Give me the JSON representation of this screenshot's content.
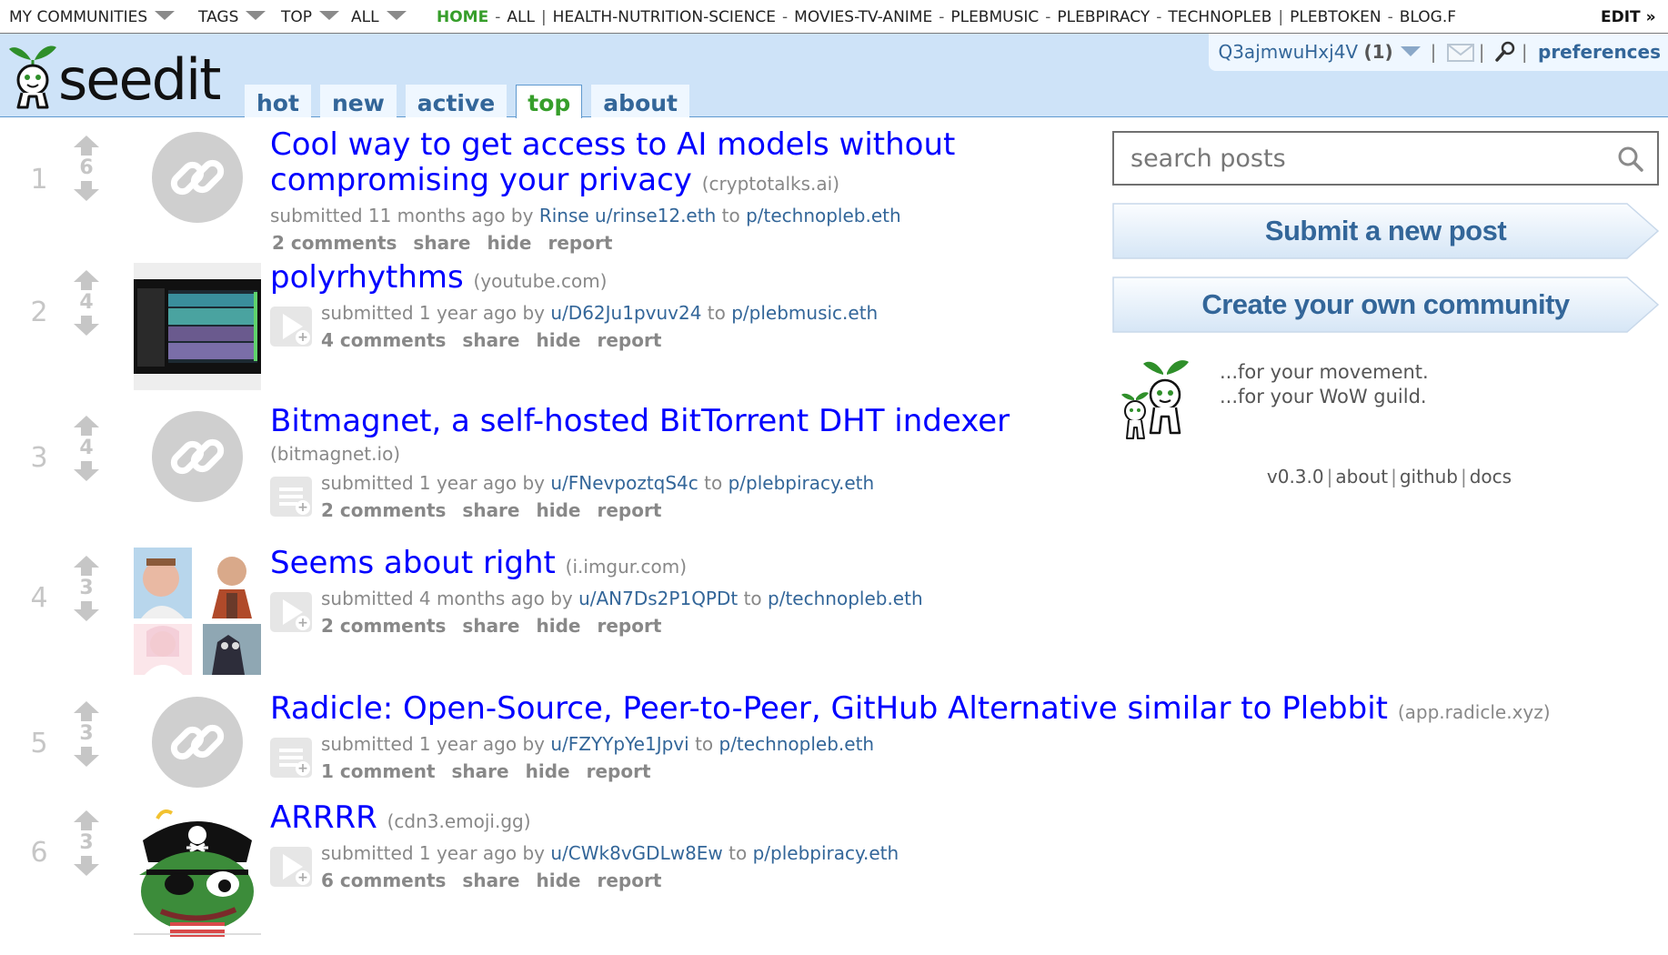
{
  "topbar": {
    "my_communities": "MY COMMUNITIES",
    "tags": "TAGS",
    "top": "TOP",
    "all": "ALL",
    "home": "HOME",
    "all_link": "ALL",
    "groups": [
      "HEALTH-NUTRITION-SCIENCE",
      "MOVIES-TV-ANIME",
      "PLEBMUSIC",
      "PLEBPIRACY",
      "TECHNOPLEB"
    ],
    "plebtoken": "PLEBTOKEN",
    "blog": "BLOG.F",
    "edit": "EDIT »"
  },
  "header": {
    "logo_text": "seedit",
    "tabs": [
      {
        "label": "hot",
        "selected": false
      },
      {
        "label": "new",
        "selected": false
      },
      {
        "label": "active",
        "selected": false
      },
      {
        "label": "top",
        "selected": true
      },
      {
        "label": "about",
        "selected": false
      }
    ],
    "user": {
      "name": "Q3ajmwuHxj4V",
      "karma": "(1)",
      "preferences": "preferences"
    }
  },
  "posts": [
    {
      "rank": "1",
      "score": "6",
      "title_line1": "Cool way to get access to AI models without",
      "title_line2": "compromising your privacy",
      "domain": "(cryptotalks.ai)",
      "submitted": "submitted 11 months ago by",
      "author_display": "Rinse",
      "author": "u/rinse12.eth",
      "to": "to",
      "community": "p/technopleb.eth",
      "comments": "2 comments",
      "share": "share",
      "hide": "hide",
      "report": "report",
      "thumbnail": "link-icon"
    },
    {
      "rank": "2",
      "score": "4",
      "title": "polyrhythms",
      "domain": "(youtube.com)",
      "submitted": "submitted 1 year ago by",
      "author": "u/D62Ju1pvuv24",
      "to": "to",
      "community": "p/plebmusic.eth",
      "comments": "4 comments",
      "share": "share",
      "hide": "hide",
      "report": "report",
      "thumbnail": "video-thumbnail"
    },
    {
      "rank": "3",
      "score": "4",
      "title": "Bitmagnet, a self-hosted BitTorrent DHT indexer",
      "domain": "(bitmagnet.io)",
      "submitted": "submitted 1 year ago by",
      "author": "u/FNevpoztqS4c",
      "to": "to",
      "community": "p/plebpiracy.eth",
      "comments": "2 comments",
      "share": "share",
      "hide": "hide",
      "report": "report",
      "thumbnail": "link-icon"
    },
    {
      "rank": "4",
      "score": "3",
      "title": "Seems about right",
      "domain": "(i.imgur.com)",
      "submitted": "submitted 4 months ago by",
      "author": "u/AN7Ds2P1QPDt",
      "to": "to",
      "community": "p/technopleb.eth",
      "comments": "2 comments",
      "share": "share",
      "hide": "hide",
      "report": "report",
      "thumbnail": "image-grid-thumbnail"
    },
    {
      "rank": "5",
      "score": "3",
      "title": "Radicle: Open-Source, Peer-to-Peer, GitHub Alternative similar to Plebbit",
      "domain": "(app.radicle.xyz)",
      "submitted": "submitted 1 year ago by",
      "author": "u/FZYYpYe1Jpvi",
      "to": "to",
      "community": "p/technopleb.eth",
      "comments": "1 comment",
      "share": "share",
      "hide": "hide",
      "report": "report",
      "thumbnail": "link-icon"
    },
    {
      "rank": "6",
      "score": "3",
      "title": "ARRRR",
      "domain": "(cdn3.emoji.gg)",
      "submitted": "submitted 1 year ago by",
      "author": "u/CWk8vGDLw8Ew",
      "to": "to",
      "community": "p/plebpiracy.eth",
      "comments": "6 comments",
      "share": "share",
      "hide": "hide",
      "report": "report",
      "thumbnail": "pirate-frog-thumbnail"
    }
  ],
  "sidebar": {
    "search_placeholder": "search posts",
    "submit_label": "Submit a new post",
    "create_label": "Create your own community",
    "promo_line1": "...for your movement.",
    "promo_line2": "...for your WoW guild.",
    "version": "v0.3.0",
    "about": "about",
    "github": "github",
    "docs": "docs"
  },
  "colors": {
    "header_bg": "#cee3f8",
    "link_blue": "#0000ff",
    "meta_blue": "#336699",
    "selected_tab_green": "#369e2a",
    "muted_gray": "#888888"
  }
}
